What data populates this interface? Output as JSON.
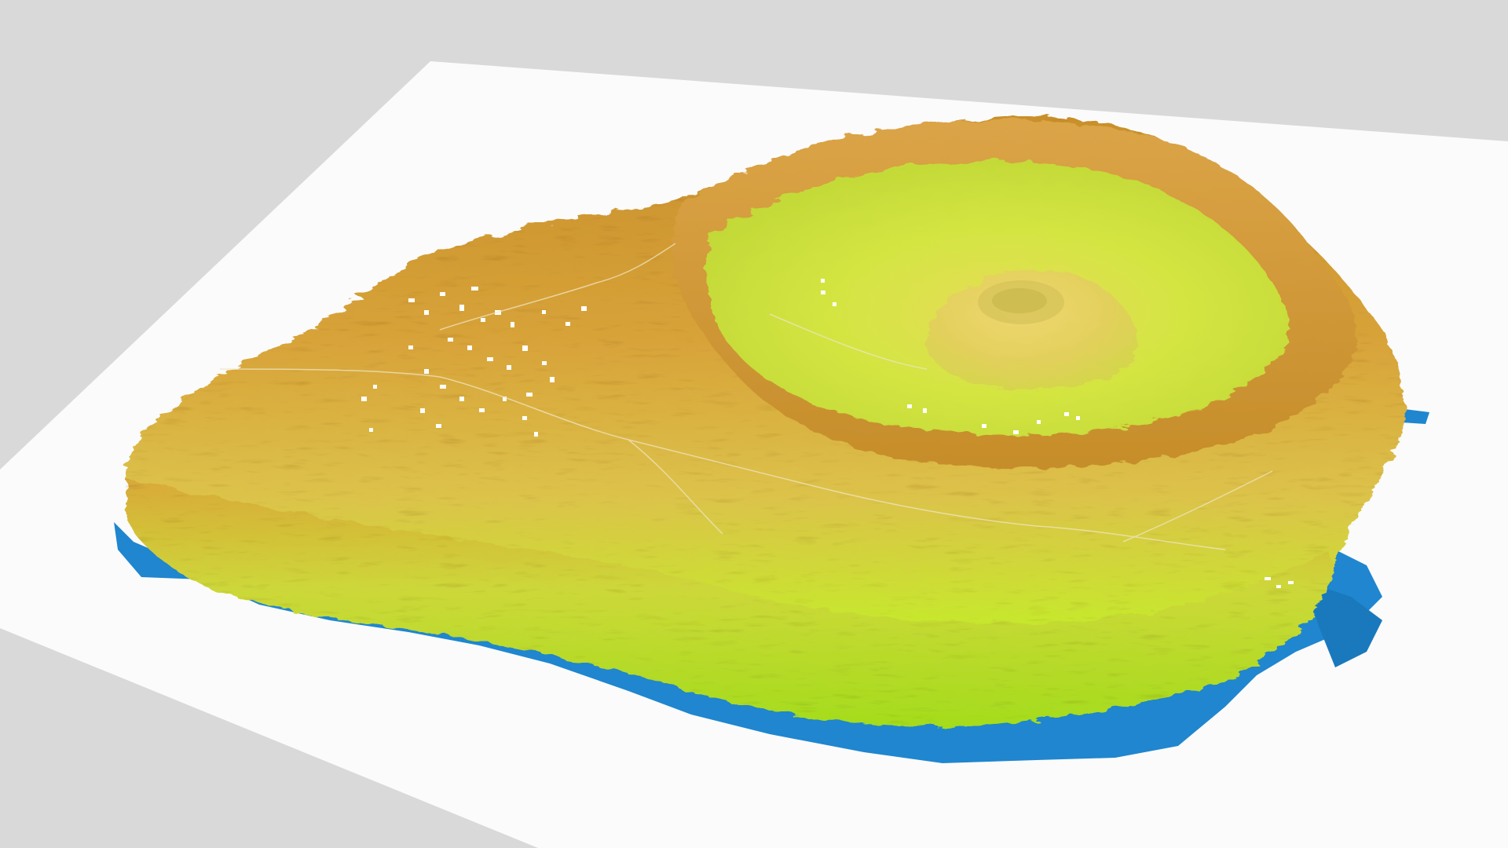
{
  "scene": {
    "subject": "3d-terrain-model",
    "background_color": "#d9d9d9",
    "base_plate_color": "#fbfbfb",
    "water_color": "#1f86cf",
    "elevation_colors": {
      "low": "#b6e61e",
      "mid": "#e2c246",
      "high": "#d29a2e",
      "crater_floor": "#cfe63a"
    },
    "features": {
      "caldera": "caldera-icon",
      "central_cone": "volcanic-cone-icon",
      "settlement": "building-cluster-icon",
      "harbor": "harbor-icon",
      "road": "road-icon"
    }
  }
}
